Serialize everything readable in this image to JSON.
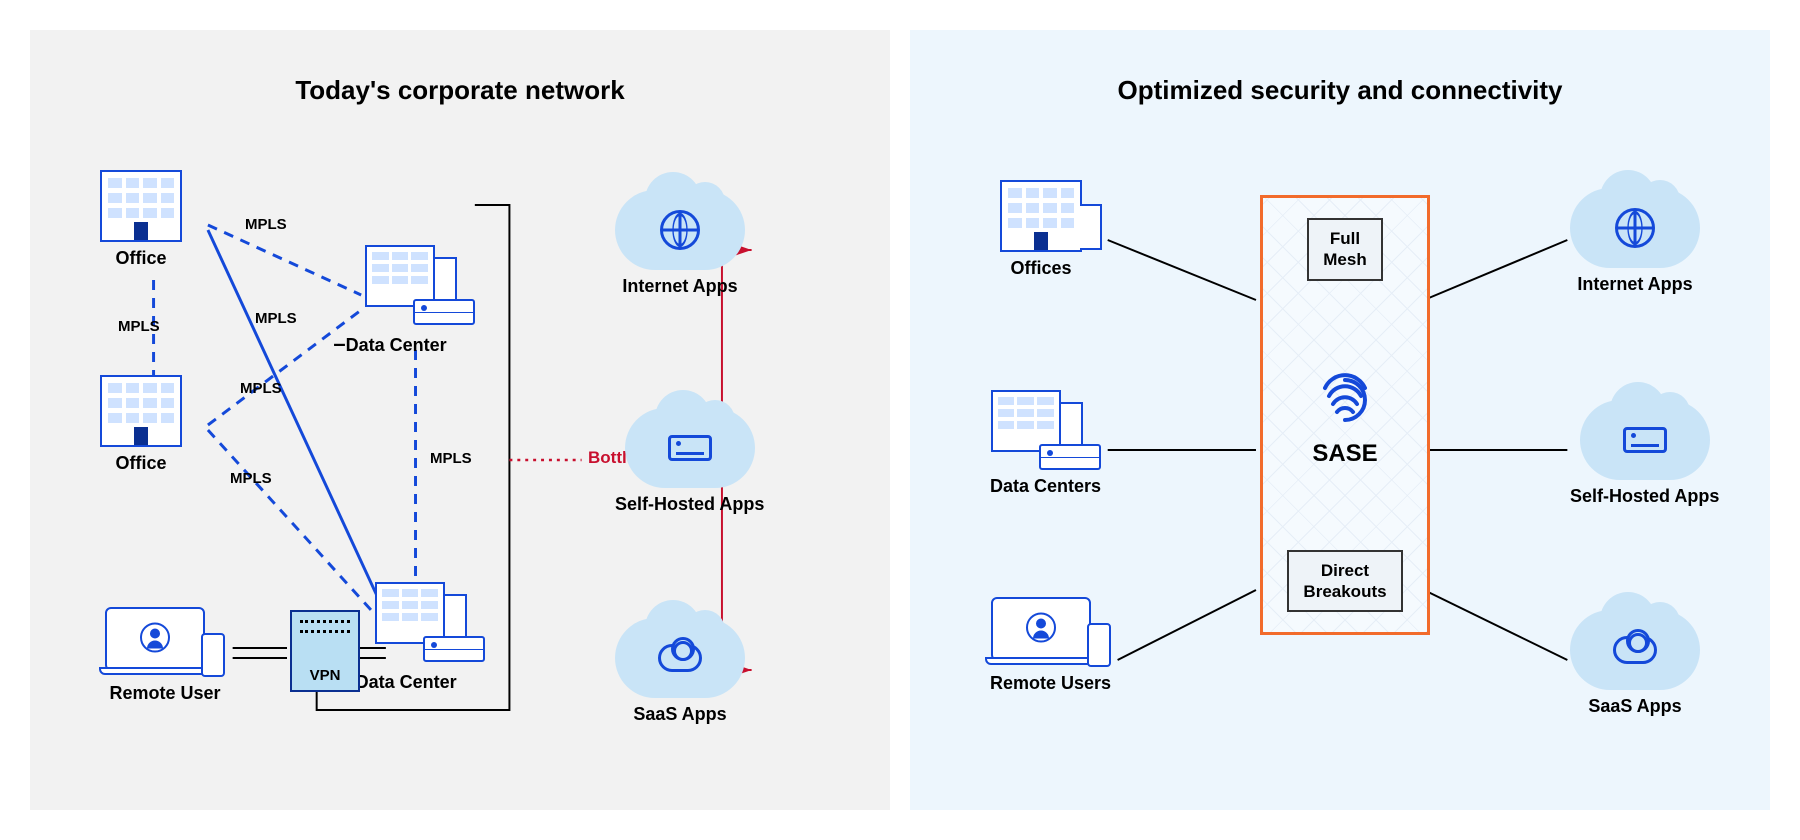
{
  "left": {
    "title": "Today's corporate network",
    "nodes": {
      "office1": "Office",
      "office2": "Office",
      "dc1": "Data Center",
      "dc2": "Data Center",
      "remote": "Remote User",
      "vpn": "VPN",
      "bottleneck": "Bottleneck",
      "mpls": "MPLS"
    },
    "clouds": {
      "internet": "Internet Apps",
      "self": "Self-Hosted Apps",
      "saas": "SaaS Apps"
    }
  },
  "right": {
    "title": "Optimized security and connectivity",
    "nodes": {
      "offices": "Offices",
      "dcs": "Data Centers",
      "remote": "Remote Users"
    },
    "sase": {
      "top": "Full\nMesh",
      "center": "SASE",
      "bottom": "Direct\nBreakouts"
    },
    "clouds": {
      "internet": "Internet Apps",
      "self": "Self-Hosted Apps",
      "saas": "SaaS Apps"
    }
  }
}
